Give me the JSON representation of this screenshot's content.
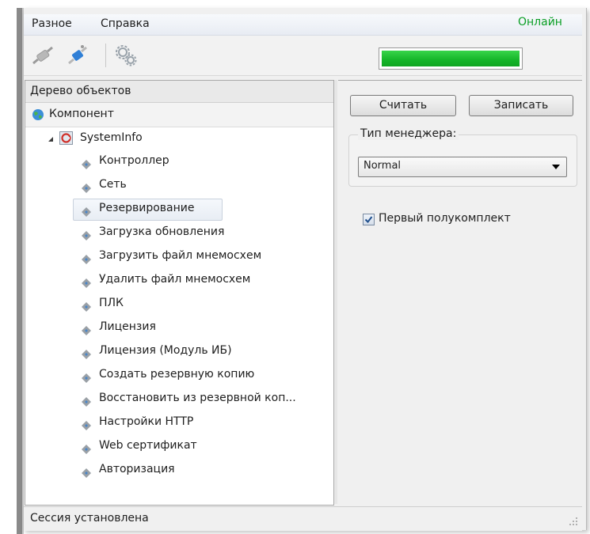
{
  "menu": {
    "items": [
      "Разное",
      "Справка"
    ]
  },
  "toolbar": {
    "status": {
      "text": "Онлайн",
      "level": 1.0,
      "color": "#0a9e24"
    }
  },
  "left_panel": {
    "header": "Дерево объектов",
    "root": "Компонент",
    "node": "SystemInfo",
    "items": [
      "Контроллер",
      "Сеть",
      "Резервирование",
      "Загрузка обновления",
      "Загрузить файл мнемосхем",
      "Удалить файл мнемосхем",
      "ПЛК",
      "Лицензия",
      "Лицензия (Модуль ИБ)",
      "Создать резервную копию",
      "Восстановить из резервной коп...",
      "Настройки HTTP",
      "Web сертификат",
      "Авторизация"
    ],
    "selected_index": 2
  },
  "right_panel": {
    "read_button": "Считать",
    "write_button": "Записать",
    "manager_label": "Тип менеджера:",
    "manager_value": "Normal",
    "checkbox_label": "Первый полукомплект",
    "checkbox_checked": true
  },
  "statusbar": {
    "text": "Сессия установлена"
  }
}
